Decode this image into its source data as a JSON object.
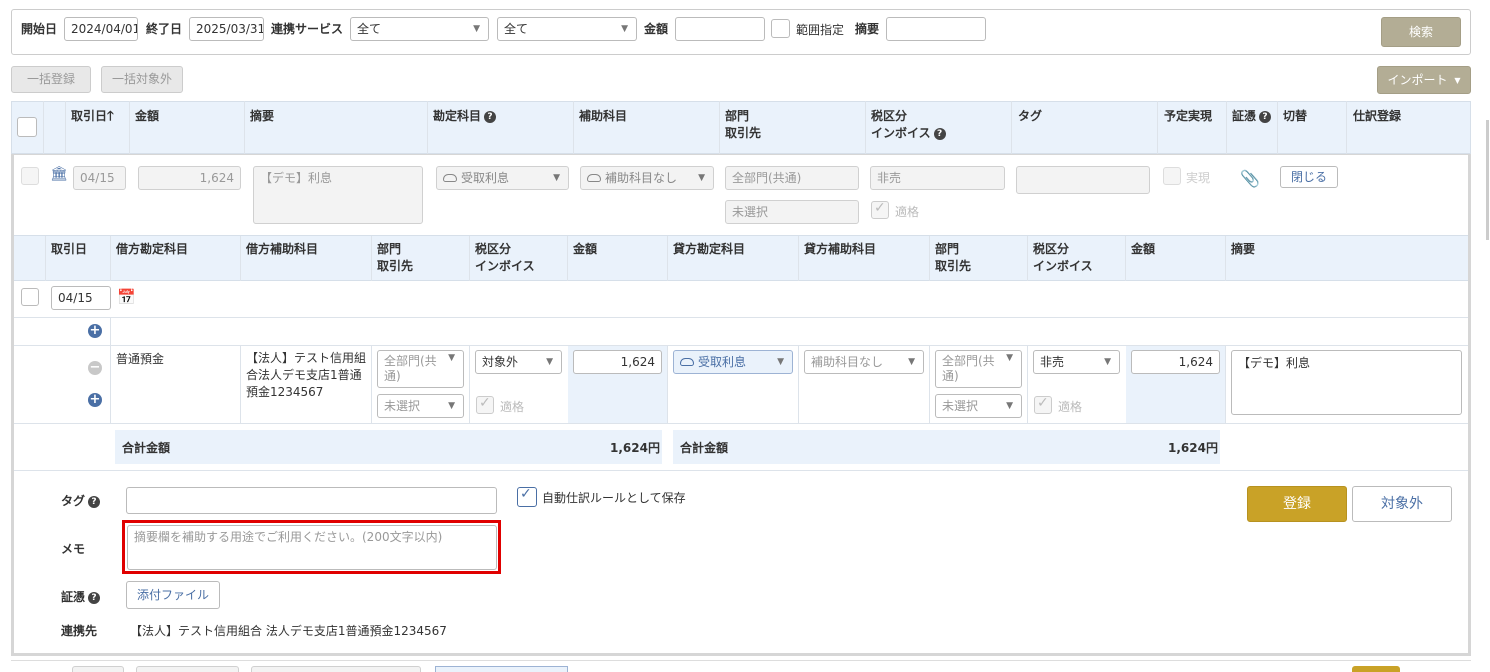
{
  "filters": {
    "start_label": "開始日",
    "start_value": "2024/04/01",
    "end_label": "終了日",
    "end_value": "2025/03/31",
    "service_label": "連携サービス",
    "service_value": "全て",
    "service2_value": "全て",
    "amount_label": "金額",
    "range_label": "範囲指定",
    "summary_label": "摘要",
    "search_label": "検索"
  },
  "toolbar": {
    "bulk_register": "一括登録",
    "bulk_exclude": "一括対象外",
    "import": "インポート"
  },
  "table_headers": {
    "date": "取引日",
    "amount": "金額",
    "summary": "摘要",
    "account": "勘定科目",
    "sub_account": "補助科目",
    "dept": "部門",
    "partner": "取引先",
    "tax": "税区分",
    "invoice": "インボイス",
    "tag": "タグ",
    "plan": "予定実現",
    "evidence": "証憑",
    "switch": "切替",
    "journal": "仕訳登録"
  },
  "row": {
    "date": "04/15",
    "amount": "1,624",
    "summary": "【デモ】利息",
    "account": "受取利息",
    "sub_account": "補助科目なし",
    "dept": "全部門(共通)",
    "partner": "未選択",
    "tax": "非売",
    "invoice_ok": "適格",
    "plan": "実現",
    "close": "閉じる"
  },
  "detail_headers": {
    "date": "取引日",
    "debit_account": "借方勘定科目",
    "debit_sub": "借方補助科目",
    "dept": "部門",
    "partner": "取引先",
    "tax": "税区分",
    "invoice": "インボイス",
    "amount": "金額",
    "credit_account": "貸方勘定科目",
    "credit_sub": "貸方補助科目",
    "dept2": "部門",
    "partner2": "取引先",
    "tax2": "税区分",
    "invoice2": "インボイス",
    "amount2": "金額",
    "summary": "摘要"
  },
  "detail": {
    "date": "04/15",
    "debit_account": "普通預金",
    "debit_sub": "【法人】テスト信用組合法人デモ支店1普通預金1234567",
    "debit_dept": "全部門(共通)",
    "debit_partner": "未選択",
    "debit_tax": "対象外",
    "debit_invoice": "適格",
    "debit_amount": "1,624",
    "credit_account": "受取利息",
    "credit_sub": "補助科目なし",
    "credit_dept": "全部門(共通)",
    "credit_partner": "未選択",
    "credit_tax": "非売",
    "credit_invoice": "適格",
    "credit_amount": "1,624",
    "summary": "【デモ】利息",
    "total_label": "合計金額",
    "debit_total": "1,624円",
    "credit_total": "1,624円"
  },
  "form": {
    "tag_label": "タグ",
    "auto_rule_label": "自動仕訳ルールとして保存",
    "memo_label": "メモ",
    "memo_placeholder": "摘要欄を補助する用途でご利用ください。(200文字以内)",
    "evidence_label": "証憑",
    "attach_label": "添付ファイル",
    "link_label": "連携先",
    "link_value": "【法人】テスト信用組合 法人デモ支店1普通預金1234567",
    "register": "登録",
    "exclude": "対象外"
  },
  "colors": {
    "header_bg": "#eaf2fb",
    "accent_blue": "#4a6fa5",
    "gold": "#c9a227",
    "highlight_red": "#e00000"
  }
}
